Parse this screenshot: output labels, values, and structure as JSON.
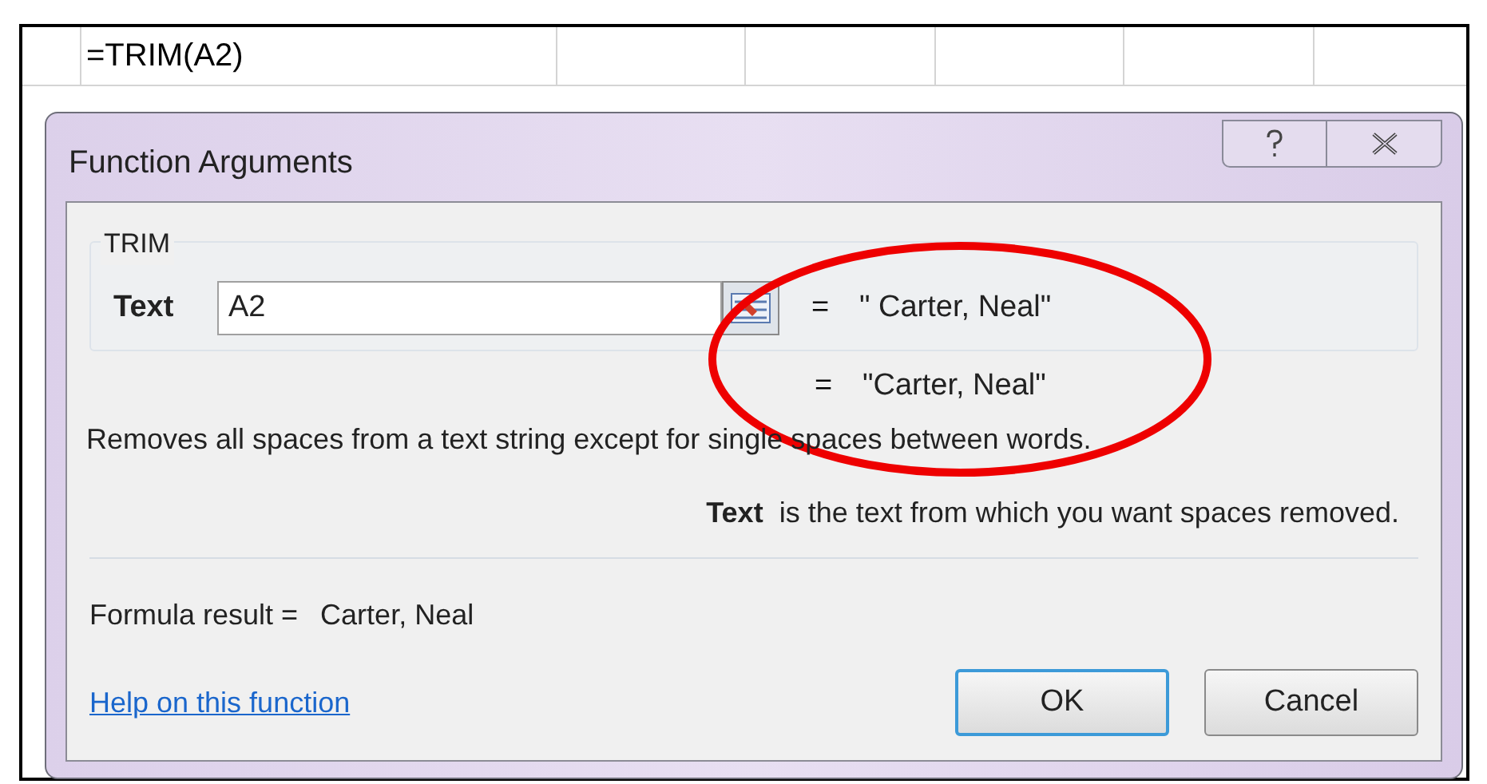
{
  "sheet": {
    "formula_cell": "=TRIM(A2)"
  },
  "dialog": {
    "title": "Function Arguments",
    "group_title": "TRIM",
    "arguments": [
      {
        "label": "Text",
        "value": "A2",
        "equals": "=",
        "result": "\" Carter, Neal\""
      }
    ],
    "result_preview": {
      "equals": "=",
      "value": "\"Carter, Neal\""
    },
    "description": "Removes all spaces from a text string except for single spaces between words.",
    "argument_help": "**Text**  is the text from which you want spaces removed.",
    "formula_result": {
      "label": "Formula result =",
      "value": "Carter, Neal"
    },
    "help_link": "Help on this function",
    "buttons": [
      {
        "label": "OK",
        "default": true
      },
      {
        "label": "Cancel",
        "default": false
      }
    ]
  },
  "annotation": {
    "kind": "ellipse"
  }
}
